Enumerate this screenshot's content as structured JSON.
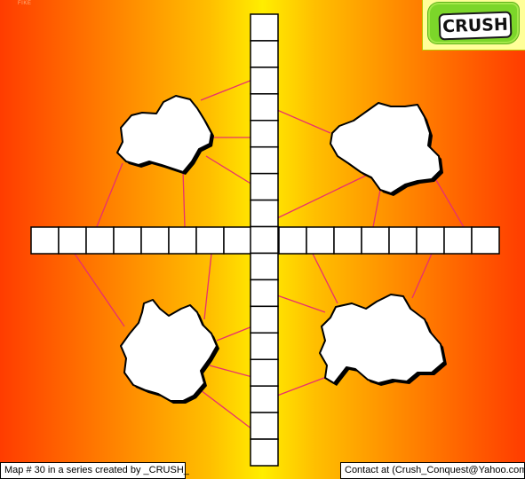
{
  "map": {
    "watermark": "FIKE",
    "logo_text": "CRUSH",
    "colors": {
      "cell_border": "#000000",
      "cell_fill": "#ffffff",
      "connector": "#e8306e",
      "continent_fill": "#ffffff",
      "continent_outline": "#000000"
    },
    "horizontal_cells": 17,
    "vertical_cells": 17,
    "continents": [
      "top-left",
      "top-right",
      "bottom-left",
      "bottom-right"
    ]
  },
  "status": {
    "left_text": "Map # 30 in a series created by _CRUSH_",
    "right_text": "Contact at (Crush_Conquest@Yahoo.com)"
  }
}
